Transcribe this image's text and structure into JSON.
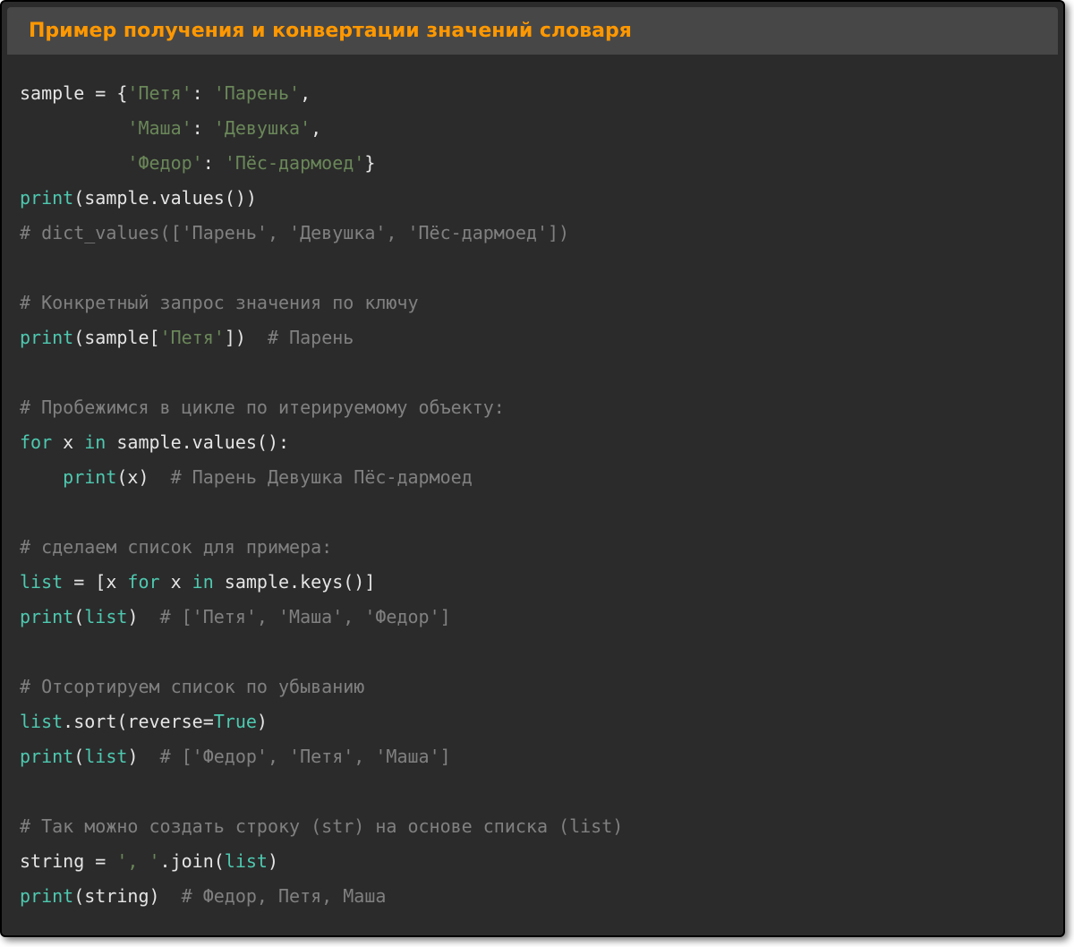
{
  "header": {
    "title": "Пример получения и конвертации значений словаря"
  },
  "code": {
    "line1": {
      "t1": "sample",
      "t2": " = ",
      "t3": "{",
      "t4": "'Петя'",
      "t5": ": ",
      "t6": "'Парень'",
      "t7": ","
    },
    "line2": {
      "pad": "          ",
      "t1": "'Маша'",
      "t2": ": ",
      "t3": "'Девушка'",
      "t4": ","
    },
    "line3": {
      "pad": "          ",
      "t1": "'Федор'",
      "t2": ": ",
      "t3": "'Пёс-дармоед'",
      "t4": "}"
    },
    "line4": {
      "t1": "print",
      "t2": "(",
      "t3": "sample.values",
      "t4": "())"
    },
    "line5": {
      "t1": "# dict_values(['Парень', 'Девушка', 'Пёс-дармоед'])"
    },
    "line7": {
      "t1": "# Конкретный запрос значения по ключу"
    },
    "line8": {
      "t1": "print",
      "t2": "(",
      "t3": "sample",
      "t4": "[",
      "t5": "'Петя'",
      "t6": "])  ",
      "t7": "# Парень"
    },
    "line10": {
      "t1": "# Пробежимся в цикле по итерируемому объекту:"
    },
    "line11": {
      "t1": "for",
      "t2": " x ",
      "t3": "in",
      "t4": " sample.values():"
    },
    "line12": {
      "pad": "    ",
      "t1": "print",
      "t2": "(x)  ",
      "t3": "# Парень Девушка Пёс-дармоед"
    },
    "line14": {
      "t1": "# сделаем список для примера:"
    },
    "line15": {
      "t1": "list",
      "t2": " = ",
      "t3": "[x ",
      "t4": "for",
      "t5": " x ",
      "t6": "in",
      "t7": " sample.keys()]"
    },
    "line16": {
      "t1": "print",
      "t2": "(",
      "t3": "list",
      "t4": ")  ",
      "t5": "# ['Петя', 'Маша', 'Федор']"
    },
    "line18": {
      "t1": "# Отсортируем список по убыванию"
    },
    "line19": {
      "t1": "list",
      "t2": ".sort(reverse=",
      "t3": "True",
      "t4": ")"
    },
    "line20": {
      "t1": "print",
      "t2": "(",
      "t3": "list",
      "t4": ")  ",
      "t5": "# ['Федор', 'Петя', 'Маша']"
    },
    "line22": {
      "t1": "# Так можно создать строку (str) на основе списка (list)"
    },
    "line23": {
      "t1": "string",
      "t2": " = ",
      "t3": "', '",
      "t4": ".join(",
      "t5": "list",
      "t6": ")"
    },
    "line24": {
      "t1": "print",
      "t2": "(string)  ",
      "t3": "# Федор, Петя, Маша"
    }
  }
}
